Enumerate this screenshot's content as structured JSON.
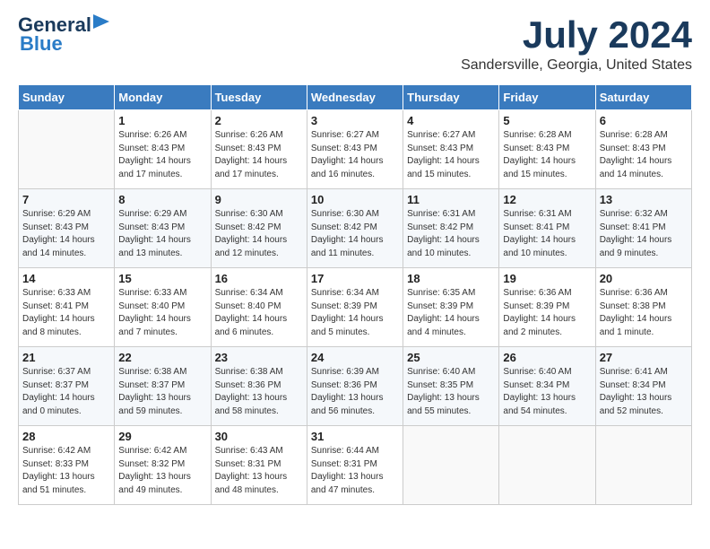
{
  "logo": {
    "line1": "General",
    "line2": "Blue",
    "arrow": true
  },
  "header": {
    "month": "July 2024",
    "location": "Sandersville, Georgia, United States"
  },
  "weekdays": [
    "Sunday",
    "Monday",
    "Tuesday",
    "Wednesday",
    "Thursday",
    "Friday",
    "Saturday"
  ],
  "weeks": [
    [
      {
        "day": "",
        "sunrise": "",
        "sunset": "",
        "daylight": ""
      },
      {
        "day": "1",
        "sunrise": "Sunrise: 6:26 AM",
        "sunset": "Sunset: 8:43 PM",
        "daylight": "Daylight: 14 hours and 17 minutes."
      },
      {
        "day": "2",
        "sunrise": "Sunrise: 6:26 AM",
        "sunset": "Sunset: 8:43 PM",
        "daylight": "Daylight: 14 hours and 17 minutes."
      },
      {
        "day": "3",
        "sunrise": "Sunrise: 6:27 AM",
        "sunset": "Sunset: 8:43 PM",
        "daylight": "Daylight: 14 hours and 16 minutes."
      },
      {
        "day": "4",
        "sunrise": "Sunrise: 6:27 AM",
        "sunset": "Sunset: 8:43 PM",
        "daylight": "Daylight: 14 hours and 15 minutes."
      },
      {
        "day": "5",
        "sunrise": "Sunrise: 6:28 AM",
        "sunset": "Sunset: 8:43 PM",
        "daylight": "Daylight: 14 hours and 15 minutes."
      },
      {
        "day": "6",
        "sunrise": "Sunrise: 6:28 AM",
        "sunset": "Sunset: 8:43 PM",
        "daylight": "Daylight: 14 hours and 14 minutes."
      }
    ],
    [
      {
        "day": "7",
        "sunrise": "Sunrise: 6:29 AM",
        "sunset": "Sunset: 8:43 PM",
        "daylight": "Daylight: 14 hours and 14 minutes."
      },
      {
        "day": "8",
        "sunrise": "Sunrise: 6:29 AM",
        "sunset": "Sunset: 8:43 PM",
        "daylight": "Daylight: 14 hours and 13 minutes."
      },
      {
        "day": "9",
        "sunrise": "Sunrise: 6:30 AM",
        "sunset": "Sunset: 8:42 PM",
        "daylight": "Daylight: 14 hours and 12 minutes."
      },
      {
        "day": "10",
        "sunrise": "Sunrise: 6:30 AM",
        "sunset": "Sunset: 8:42 PM",
        "daylight": "Daylight: 14 hours and 11 minutes."
      },
      {
        "day": "11",
        "sunrise": "Sunrise: 6:31 AM",
        "sunset": "Sunset: 8:42 PM",
        "daylight": "Daylight: 14 hours and 10 minutes."
      },
      {
        "day": "12",
        "sunrise": "Sunrise: 6:31 AM",
        "sunset": "Sunset: 8:41 PM",
        "daylight": "Daylight: 14 hours and 10 minutes."
      },
      {
        "day": "13",
        "sunrise": "Sunrise: 6:32 AM",
        "sunset": "Sunset: 8:41 PM",
        "daylight": "Daylight: 14 hours and 9 minutes."
      }
    ],
    [
      {
        "day": "14",
        "sunrise": "Sunrise: 6:33 AM",
        "sunset": "Sunset: 8:41 PM",
        "daylight": "Daylight: 14 hours and 8 minutes."
      },
      {
        "day": "15",
        "sunrise": "Sunrise: 6:33 AM",
        "sunset": "Sunset: 8:40 PM",
        "daylight": "Daylight: 14 hours and 7 minutes."
      },
      {
        "day": "16",
        "sunrise": "Sunrise: 6:34 AM",
        "sunset": "Sunset: 8:40 PM",
        "daylight": "Daylight: 14 hours and 6 minutes."
      },
      {
        "day": "17",
        "sunrise": "Sunrise: 6:34 AM",
        "sunset": "Sunset: 8:39 PM",
        "daylight": "Daylight: 14 hours and 5 minutes."
      },
      {
        "day": "18",
        "sunrise": "Sunrise: 6:35 AM",
        "sunset": "Sunset: 8:39 PM",
        "daylight": "Daylight: 14 hours and 4 minutes."
      },
      {
        "day": "19",
        "sunrise": "Sunrise: 6:36 AM",
        "sunset": "Sunset: 8:39 PM",
        "daylight": "Daylight: 14 hours and 2 minutes."
      },
      {
        "day": "20",
        "sunrise": "Sunrise: 6:36 AM",
        "sunset": "Sunset: 8:38 PM",
        "daylight": "Daylight: 14 hours and 1 minute."
      }
    ],
    [
      {
        "day": "21",
        "sunrise": "Sunrise: 6:37 AM",
        "sunset": "Sunset: 8:37 PM",
        "daylight": "Daylight: 14 hours and 0 minutes."
      },
      {
        "day": "22",
        "sunrise": "Sunrise: 6:38 AM",
        "sunset": "Sunset: 8:37 PM",
        "daylight": "Daylight: 13 hours and 59 minutes."
      },
      {
        "day": "23",
        "sunrise": "Sunrise: 6:38 AM",
        "sunset": "Sunset: 8:36 PM",
        "daylight": "Daylight: 13 hours and 58 minutes."
      },
      {
        "day": "24",
        "sunrise": "Sunrise: 6:39 AM",
        "sunset": "Sunset: 8:36 PM",
        "daylight": "Daylight: 13 hours and 56 minutes."
      },
      {
        "day": "25",
        "sunrise": "Sunrise: 6:40 AM",
        "sunset": "Sunset: 8:35 PM",
        "daylight": "Daylight: 13 hours and 55 minutes."
      },
      {
        "day": "26",
        "sunrise": "Sunrise: 6:40 AM",
        "sunset": "Sunset: 8:34 PM",
        "daylight": "Daylight: 13 hours and 54 minutes."
      },
      {
        "day": "27",
        "sunrise": "Sunrise: 6:41 AM",
        "sunset": "Sunset: 8:34 PM",
        "daylight": "Daylight: 13 hours and 52 minutes."
      }
    ],
    [
      {
        "day": "28",
        "sunrise": "Sunrise: 6:42 AM",
        "sunset": "Sunset: 8:33 PM",
        "daylight": "Daylight: 13 hours and 51 minutes."
      },
      {
        "day": "29",
        "sunrise": "Sunrise: 6:42 AM",
        "sunset": "Sunset: 8:32 PM",
        "daylight": "Daylight: 13 hours and 49 minutes."
      },
      {
        "day": "30",
        "sunrise": "Sunrise: 6:43 AM",
        "sunset": "Sunset: 8:31 PM",
        "daylight": "Daylight: 13 hours and 48 minutes."
      },
      {
        "day": "31",
        "sunrise": "Sunrise: 6:44 AM",
        "sunset": "Sunset: 8:31 PM",
        "daylight": "Daylight: 13 hours and 47 minutes."
      },
      {
        "day": "",
        "sunrise": "",
        "sunset": "",
        "daylight": ""
      },
      {
        "day": "",
        "sunrise": "",
        "sunset": "",
        "daylight": ""
      },
      {
        "day": "",
        "sunrise": "",
        "sunset": "",
        "daylight": ""
      }
    ]
  ]
}
